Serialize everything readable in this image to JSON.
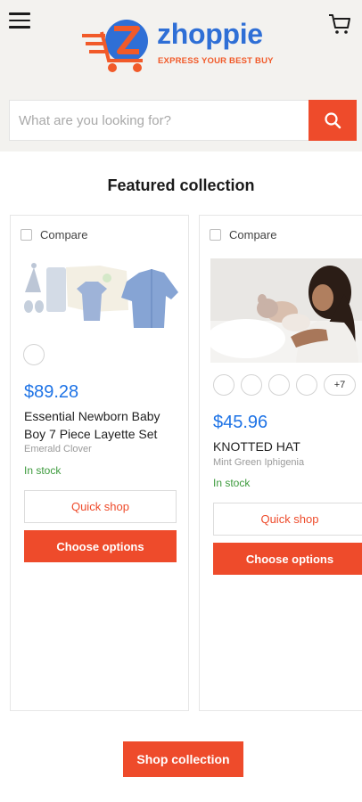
{
  "header": {
    "logo_word": "zhoppie",
    "logo_tagline": "EXPRESS YOUR BEST BUY",
    "menu_icon": "hamburger-menu-icon",
    "cart_icon": "cart-icon"
  },
  "search": {
    "placeholder": "What are you looking for?",
    "value": "",
    "icon": "search-icon"
  },
  "section": {
    "title": "Featured collection"
  },
  "products": [
    {
      "compare_label": "Compare",
      "price": "$89.28",
      "name": "Essential Newborn Baby Boy 7 Piece Layette Set",
      "vendor": "Emerald Clover",
      "stock": "In stock",
      "quick_shop": "Quick shop",
      "choose_options": "Choose options"
    },
    {
      "compare_label": "Compare",
      "swatch_more": "+7",
      "price": "$45.96",
      "name": "KNOTTED HAT",
      "vendor": "Mint Green Iphigenia",
      "stock": "In stock",
      "quick_shop": "Quick shop",
      "choose_options": "Choose options"
    }
  ],
  "footer": {
    "shop_collection": "Shop collection"
  },
  "colors": {
    "accent": "#ee4b2b",
    "brand_blue": "#2f6fd6",
    "price_blue": "#1e73e6",
    "stock_green": "#3c9a3c"
  }
}
